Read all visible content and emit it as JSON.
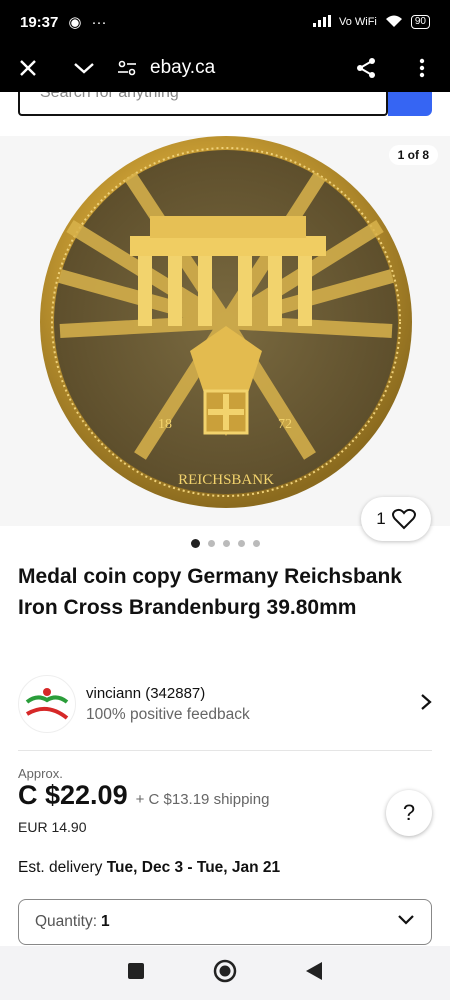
{
  "status_bar": {
    "time": "19:37",
    "network": "Vo WiFi",
    "battery": "90"
  },
  "browser": {
    "url": "ebay.ca"
  },
  "search": {
    "placeholder": "Search for anything"
  },
  "gallery": {
    "counter": "1 of 8",
    "watch_count": "1",
    "total_images": 5,
    "active_image": 1
  },
  "item": {
    "title": "Medal coin copy Germany Reichsbank Iron Cross Brandenburg 39.80mm",
    "coin_inscription": "REICHSBANK",
    "coin_year_left": "18",
    "coin_year_right": "72"
  },
  "seller": {
    "name": "vinciann (342887)",
    "feedback": "100% positive feedback"
  },
  "pricing": {
    "approx_label": "Approx.",
    "price": "C $22.09",
    "shipping": "+ C $13.19 shipping",
    "original_price": "EUR 14.90"
  },
  "delivery": {
    "label": "Est. delivery",
    "dates": "Tue, Dec 3 - Tue, Jan 21"
  },
  "quantity": {
    "label": "Quantity:",
    "value": "1"
  },
  "colors": {
    "accent": "#3665f3",
    "gold": "#c9a13a"
  }
}
